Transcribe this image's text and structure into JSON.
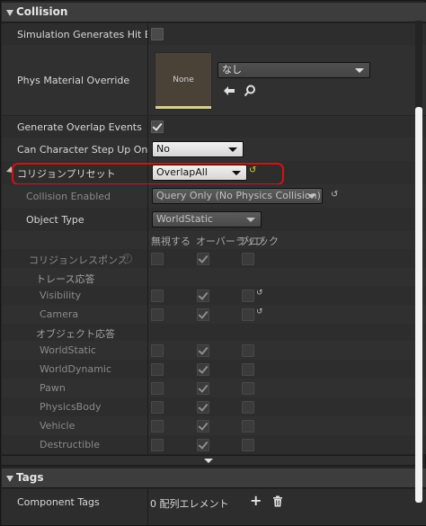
{
  "collision": {
    "header": "Collision",
    "sim_hit_events_label": "Simulation Generates Hit Eve",
    "phys_material_label": "Phys Material Override",
    "material_thumb_text": "None",
    "material_combo_value": "なし",
    "generate_overlap_label": "Generate Overlap Events",
    "step_up_label": "Can Character Step Up On",
    "step_up_value": "No",
    "preset_label": "コリジョンプリセット",
    "preset_value": "OverlapAll",
    "collision_enabled_label": "Collision Enabled",
    "collision_enabled_value": "Query Only (No Physics Collision)",
    "object_type_label": "Object Type",
    "object_type_value": "WorldStatic",
    "col_ignore": "無視する",
    "col_overlap": "オーバーラップ",
    "col_block": "ブロック",
    "responses_label": "コリジョンレスポンス",
    "trace_label": "トレース応答",
    "object_label": "オブジェクト応答",
    "trace_rows": [
      {
        "label": "Visibility"
      },
      {
        "label": "Camera"
      }
    ],
    "object_rows": [
      {
        "label": "WorldStatic"
      },
      {
        "label": "WorldDynamic"
      },
      {
        "label": "Pawn"
      },
      {
        "label": "PhysicsBody"
      },
      {
        "label": "Vehicle"
      },
      {
        "label": "Destructible"
      }
    ]
  },
  "tags": {
    "header": "Tags",
    "component_tags_label": "Component Tags",
    "component_tags_value": "0 配列エレメント"
  },
  "icons": {
    "reset": "↺",
    "back": "🡐",
    "search": "⌕",
    "add": "+",
    "delete": "trash-icon",
    "help": "?"
  },
  "colors": {
    "highlight": "#d81010",
    "reset_yellow": "#e8d030"
  }
}
